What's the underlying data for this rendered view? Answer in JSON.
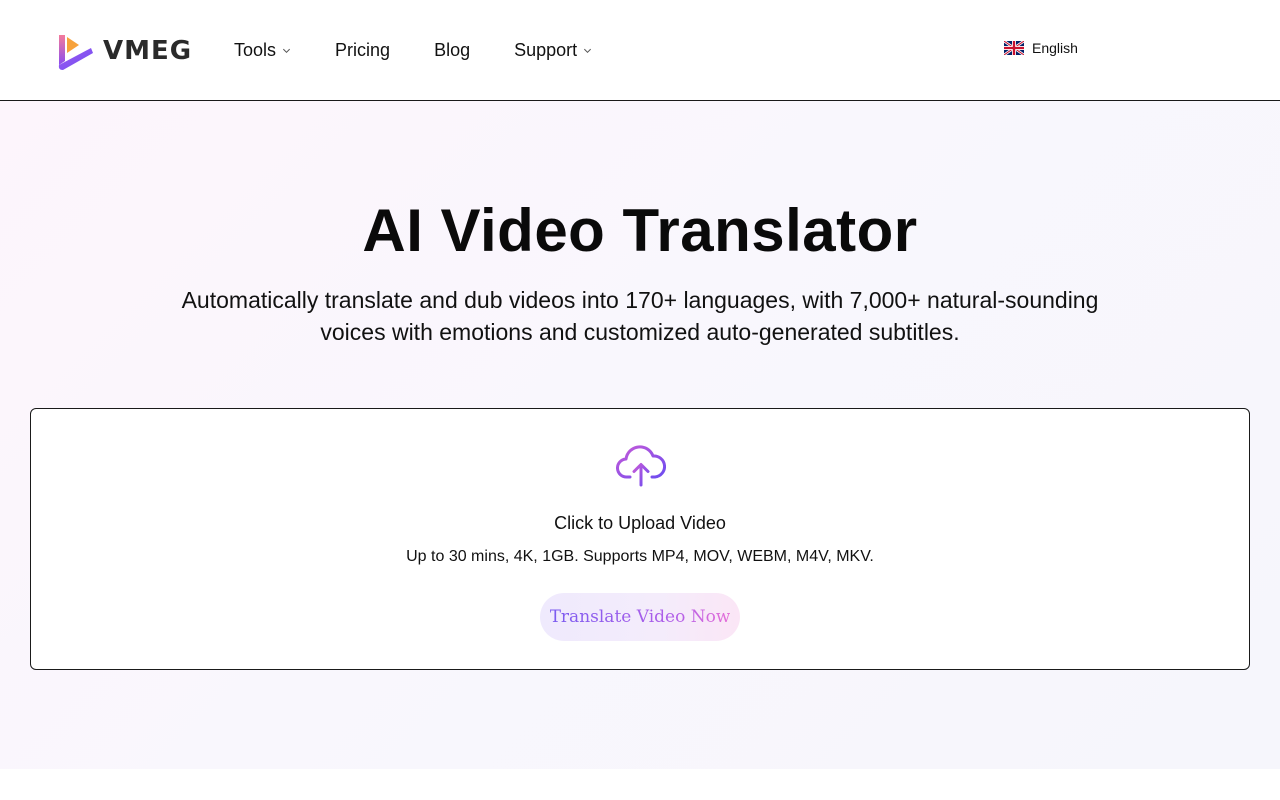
{
  "brand": {
    "name": "VMEG",
    "logo_icon": "play-triangle-logo-icon",
    "colors": {
      "orange": "#f7a23b",
      "pink": "#ec5a9e",
      "purple": "#7b4cf0"
    }
  },
  "nav": {
    "items": [
      {
        "label": "Tools",
        "has_dropdown": true
      },
      {
        "label": "Pricing",
        "has_dropdown": false
      },
      {
        "label": "Blog",
        "has_dropdown": false
      },
      {
        "label": "Support",
        "has_dropdown": true
      }
    ],
    "language": {
      "label": "English",
      "flag_icon": "uk-flag-icon"
    }
  },
  "hero": {
    "title": "AI Video Translator",
    "subtitle": "Automatically translate and dub videos into 170+ languages, with 7,000+ natural-sounding voices with emotions and customized auto-generated subtitles."
  },
  "upload": {
    "icon": "cloud-upload-icon",
    "title": "Click to Upload Video",
    "hint": "Up to 30 mins, 4K, 1GB. Supports MP4, MOV, WEBM, M4V, MKV.",
    "button_label": "Translate Video Now",
    "accent_colors": {
      "start": "#7b5cf0",
      "end": "#e56fd8"
    }
  }
}
